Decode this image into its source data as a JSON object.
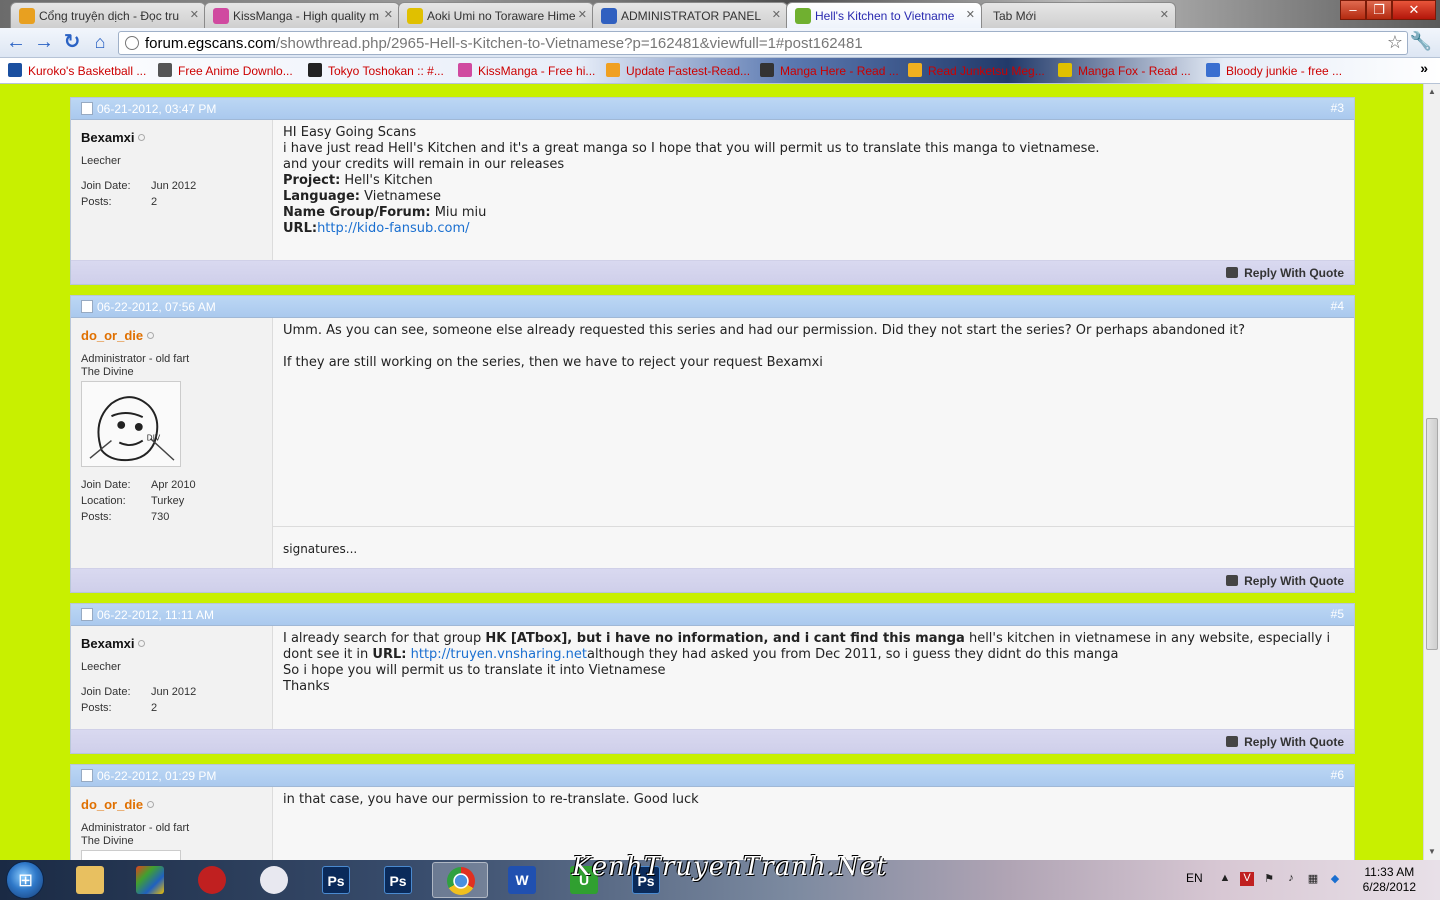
{
  "browser": {
    "tabs": [
      {
        "label": "Cổng truyện dịch - Đọc tru",
        "icon_color": "#e8a020"
      },
      {
        "label": "KissManga - High quality m",
        "icon_color": "#d04aa0"
      },
      {
        "label": "Aoki Umi no Toraware Hime",
        "icon_color": "#e0c000"
      },
      {
        "label": "ADMINISTRATOR PANEL",
        "icon_color": "#3060c0"
      },
      {
        "label": "Hell's Kitchen to Vietname",
        "icon_color": "#70b030"
      },
      {
        "label": "Tab Mới",
        "icon_color": ""
      }
    ],
    "url_domain": "forum.egscans.com",
    "url_path": "/showthread.php/2965-Hell-s-Kitchen-to-Vietnamese?p=162481&viewfull=1#post162481",
    "bookmarks": [
      {
        "label": "Kuroko's Basketball ...",
        "icon_color": "#1a4fa0"
      },
      {
        "label": "Free Anime Downlo...",
        "icon_color": "#555555"
      },
      {
        "label": "Tokyo Toshokan :: #...",
        "icon_color": "#222222"
      },
      {
        "label": "KissManga - Free hi...",
        "icon_color": "#d04aa0"
      },
      {
        "label": "Update Fastest-Read...",
        "icon_color": "#f0a020"
      },
      {
        "label": "Manga Here - Read ...",
        "icon_color": "#333333"
      },
      {
        "label": "Read Junketsu Meg...",
        "icon_color": "#f0b020"
      },
      {
        "label": "Manga Fox - Read ...",
        "icon_color": "#e0c000"
      },
      {
        "label": "Bloody junkie - free ...",
        "icon_color": "#3a6fd0"
      }
    ],
    "more_bookmarks": "»"
  },
  "posts": [
    {
      "date": "06-21-2012, 03:47 PM",
      "number": "#3",
      "username": "Bexamxi",
      "is_admin": false,
      "user_title_1": "Leecher",
      "user_title_2": "",
      "details": [
        {
          "k": "Join Date:",
          "v": "Jun 2012"
        },
        {
          "k": "Posts:",
          "v": "2"
        }
      ],
      "reply_label": "Reply With Quote"
    },
    {
      "date": "06-22-2012, 07:56 AM",
      "number": "#4",
      "username": "do_or_die",
      "is_admin": true,
      "user_title_1": "Administrator - old fart",
      "user_title_2": "The Divine",
      "details": [
        {
          "k": "Join Date:",
          "v": "Apr 2010"
        },
        {
          "k": "Location:",
          "v": "Turkey"
        },
        {
          "k": "Posts:",
          "v": "730"
        }
      ],
      "signature": "signatures...",
      "reply_label": "Reply With Quote"
    },
    {
      "date": "06-22-2012, 11:11 AM",
      "number": "#5",
      "username": "Bexamxi",
      "is_admin": false,
      "user_title_1": "Leecher",
      "user_title_2": "",
      "details": [
        {
          "k": "Join Date:",
          "v": "Jun 2012"
        },
        {
          "k": "Posts:",
          "v": "2"
        }
      ],
      "reply_label": "Reply With Quote"
    },
    {
      "date": "06-22-2012, 01:29 PM",
      "number": "#6",
      "username": "do_or_die",
      "is_admin": true,
      "user_title_1": "Administrator - old fart",
      "user_title_2": "The Divine",
      "details": [],
      "reply_label": "Reply With Quote"
    }
  ],
  "post3": {
    "line1": "HI Easy Going Scans",
    "line2": "i have just read Hell's Kitchen and it's a great manga so I hope that you will permit us to translate this manga to vietnamese.",
    "line3": "and your credits will remain in our releases",
    "project_label": "Project:",
    "project_value": " Hell's Kitchen",
    "language_label": "Language:",
    "language_value": " Vietnamese",
    "group_label": "Name Group/Forum:",
    "group_value": " Miu miu",
    "url_label": "URL:",
    "url_value": "http://kido-fansub.com/"
  },
  "post4": {
    "line1": "Umm. As you can see, someone else already requested this series and had our permission. Did they not start the series? Or perhaps abandoned it?",
    "line2": "If they are still working on the series, then we have to reject your request Bexamxi"
  },
  "post5": {
    "a": "I already search for that group ",
    "b": "HK [ATbox], but i have no information, and i cant find this manga",
    "c": " hell's kitchen in vietnamese in any website, especially i dont see it in ",
    "d": "URL:",
    "e": "http://truyen.vnsharing.net",
    "f": "although they had asked you from Dec 2011, so i guess they didnt do this manga",
    "line2": "So i hope you will permit us to translate it into Vietnamese",
    "line3": "Thanks"
  },
  "post6": {
    "line1": "in that case, you have our permission to re-translate. Good luck"
  },
  "taskbar": {
    "watermark": "KenhTruyenTranh.Net",
    "language": "EN",
    "time": "11:33 AM",
    "date": "6/28/2012"
  },
  "icons": {
    "back": "back-arrow-icon",
    "forward": "forward-arrow-icon",
    "reload": "reload-icon",
    "home": "home-icon",
    "star": "bookmark-star-icon",
    "wrench": "wrench-menu-icon"
  }
}
